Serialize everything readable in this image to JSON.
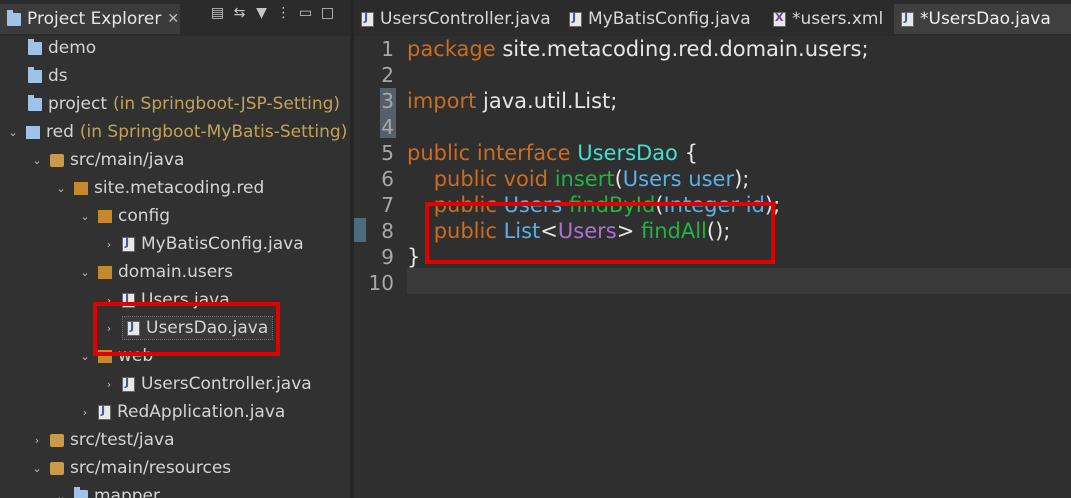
{
  "explorer": {
    "title": "Project Explorer",
    "close_glyph": "✕",
    "tree": [
      {
        "label": "demo",
        "icon": "folder-icon",
        "suffix": "",
        "chev": ""
      },
      {
        "label": "ds",
        "icon": "folder-icon",
        "suffix": "",
        "chev": ""
      },
      {
        "label": "project",
        "icon": "folder-icon",
        "suffix": "(in Springboot-JSP-Setting)",
        "chev": ""
      },
      {
        "label": "red",
        "icon": "project-icon",
        "suffix": "(in Springboot-MyBatis-Setting)",
        "chev": "⌄"
      },
      {
        "label": "src/main/java",
        "icon": "source-folder-icon",
        "suffix": "",
        "chev": "⌄"
      },
      {
        "label": "site.metacoding.red",
        "icon": "package-icon",
        "suffix": "",
        "chev": "⌄"
      },
      {
        "label": "config",
        "icon": "package-icon",
        "suffix": "",
        "chev": "⌄"
      },
      {
        "label": "MyBatisConfig.java",
        "icon": "java-file-icon",
        "suffix": "",
        "chev": "›"
      },
      {
        "label": "domain.users",
        "icon": "package-icon",
        "suffix": "",
        "chev": "⌄"
      },
      {
        "label": "Users.java",
        "icon": "java-file-icon",
        "suffix": "",
        "chev": "›"
      },
      {
        "label": "UsersDao.java",
        "icon": "java-file-icon",
        "suffix": "",
        "chev": "›"
      },
      {
        "label": "web",
        "icon": "package-icon",
        "suffix": "",
        "chev": "⌄"
      },
      {
        "label": "UsersController.java",
        "icon": "java-file-icon",
        "suffix": "",
        "chev": "›"
      },
      {
        "label": "RedApplication.java",
        "icon": "java-file-icon",
        "suffix": "",
        "chev": "›"
      },
      {
        "label": "src/test/java",
        "icon": "source-folder-icon",
        "suffix": "",
        "chev": "›"
      },
      {
        "label": "src/main/resources",
        "icon": "source-folder-icon",
        "suffix": "",
        "chev": "⌄"
      },
      {
        "label": "mapper",
        "icon": "folder-icon",
        "suffix": "",
        "chev": "⌄"
      }
    ]
  },
  "editor": {
    "tabs": [
      {
        "label": "UsersController.java",
        "icon": "java-file-icon",
        "active": false
      },
      {
        "label": "MyBatisConfig.java",
        "icon": "java-file-icon",
        "active": false
      },
      {
        "label": "*users.xml",
        "icon": "xml-file-icon",
        "active": false
      },
      {
        "label": "*UsersDao.java",
        "icon": "java-file-icon",
        "active": true
      }
    ],
    "line_numbers": [
      "1",
      "2",
      "3",
      "4",
      "5",
      "6",
      "7",
      "8",
      "9",
      "10"
    ],
    "code": {
      "l1_kw": "package",
      "l1_rest": " site.metacoding.red.domain.users;",
      "l3_kw": "import",
      "l3_rest": " java.util.List;",
      "l5_kw1": "public",
      "l5_kw2": " interface",
      "l5_cls": " UsersDao",
      "l5_rest": " {",
      "l6_kw1": "    public",
      "l6_kw2": " void",
      "l6_meth": " insert",
      "l6_p1": "(",
      "l6_type": "Users",
      "l6_arg": " user",
      "l6_p2": ");",
      "l7_kw1": "    public",
      "l7_type": " Users",
      "l7_meth": " findById",
      "l7_p1": "(",
      "l7_type2": "Integer",
      "l7_arg": " id",
      "l7_p2": ");",
      "l8_kw1": "    public",
      "l8_type": " List",
      "l8_lt": "<",
      "l8_gen": "Users",
      "l8_gt": ">",
      "l8_meth": " findAll",
      "l8_p": "();",
      "l9": "}"
    }
  },
  "colors": {
    "keyword": "#cc6c1d",
    "type": "#5ab0e8",
    "method": "#1eb540",
    "highlight": "#e00000"
  }
}
